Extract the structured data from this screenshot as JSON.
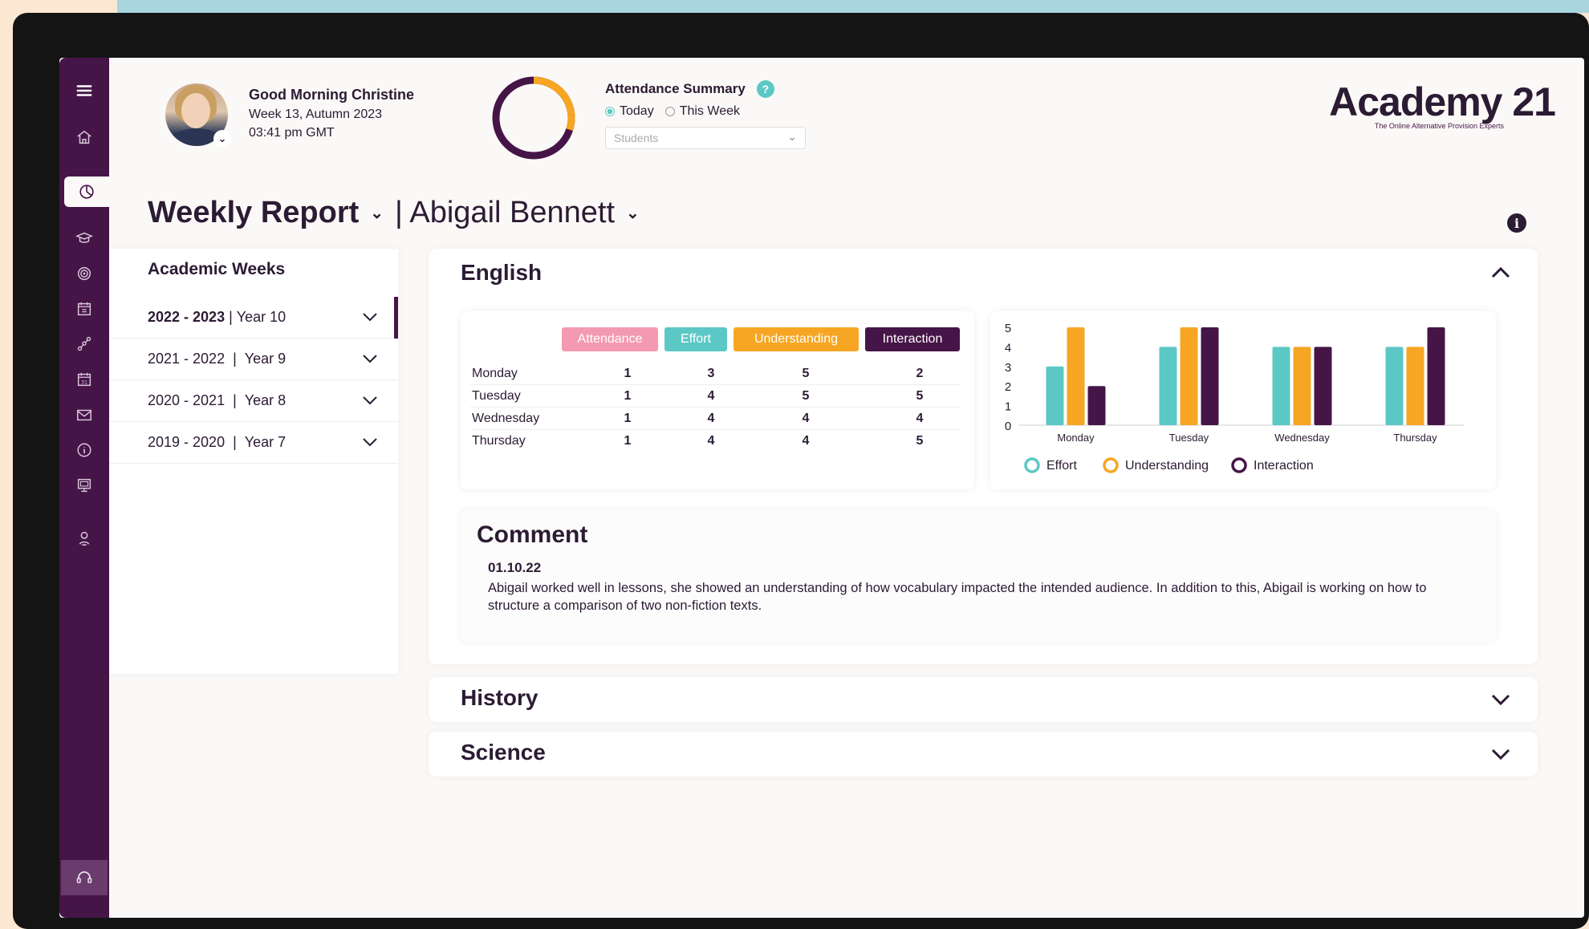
{
  "header": {
    "greeting": "Good Morning Christine",
    "week": "Week 13, Autumn 2023",
    "time": "03:41 pm GMT",
    "attendance": {
      "title": "Attendance Summary",
      "help": "?",
      "radio_today": "Today",
      "radio_week": "This Week",
      "selected": "Today",
      "select_placeholder": "Students",
      "donut_fraction": 0.3
    },
    "logo": {
      "name": "Academy 21",
      "tagline": "The Online Alternative Provision Experts"
    }
  },
  "colors": {
    "purple": "#461548",
    "teal": "#5cc8c5",
    "orange": "#f6a623",
    "pink": "#f49ab0",
    "dark": "#2b1b33"
  },
  "title": {
    "report": "Weekly Report",
    "student": "| Abigail Bennett",
    "info": "i"
  },
  "weeks": {
    "title": "Academic Weeks",
    "items": [
      {
        "years": "2022 - 2023",
        "sep": " | ",
        "year": "Year 10",
        "active": true
      },
      {
        "years": "2021 - 2022",
        "sep": "  |  ",
        "year": "Year 9"
      },
      {
        "years": "2020 - 2021",
        "sep": "  |  ",
        "year": "Year 8"
      },
      {
        "years": "2019 - 2020",
        "sep": "  |  ",
        "year": "Year 7"
      }
    ]
  },
  "english": {
    "title": "English",
    "columns": [
      "Attendance",
      "Effort",
      "Understanding",
      "Interaction"
    ],
    "rows": [
      {
        "day": "Monday",
        "values": [
          1,
          3,
          5,
          2
        ]
      },
      {
        "day": "Tuesday",
        "values": [
          1,
          4,
          5,
          5
        ]
      },
      {
        "day": "Wednesday",
        "values": [
          1,
          4,
          4,
          4
        ]
      },
      {
        "day": "Thursday",
        "values": [
          1,
          4,
          4,
          5
        ]
      }
    ],
    "comment": {
      "title": "Comment",
      "date": "01.10.22",
      "text": "Abigail worked well in lessons, she showed an understanding of how vocabulary impacted the intended audience. In addition to this, Abigail is working on how to structure a comparison of two non-fiction texts."
    }
  },
  "chart_data": {
    "type": "bar",
    "categories": [
      "Monday",
      "Tuesday",
      "Wednesday",
      "Thursday"
    ],
    "series": [
      {
        "name": "Effort",
        "color": "#5cc8c5",
        "values": [
          3,
          4,
          4,
          4
        ]
      },
      {
        "name": "Understanding",
        "color": "#f6a623",
        "values": [
          5,
          5,
          4,
          4
        ]
      },
      {
        "name": "Interaction",
        "color": "#461548",
        "values": [
          2,
          5,
          4,
          5
        ]
      }
    ],
    "yticks": [
      "5",
      "4",
      "3",
      "2",
      "1",
      "0"
    ],
    "ylim": [
      0,
      5
    ],
    "legend": "bottom"
  },
  "history": {
    "title": "History"
  },
  "science": {
    "title": "Science"
  }
}
